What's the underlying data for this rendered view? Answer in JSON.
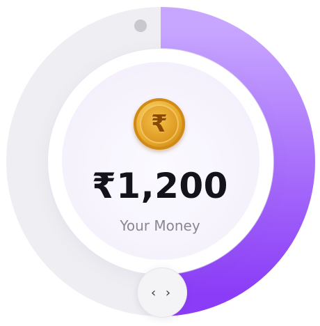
{
  "balance": {
    "currency_symbol": "₹",
    "amount_text": "₹1,200",
    "caption": "Your Money",
    "progress_fraction": 0.5
  },
  "coin": {
    "symbol": "₹"
  },
  "handle": {
    "glyph": "‹ ›",
    "icon": "chevrons-left-right-icon"
  },
  "colors": {
    "ring_track": "#efeef2",
    "ring_fill_start": "#c7a6ff",
    "ring_fill_end": "#8b3cf7",
    "amount_text": "#14121a",
    "caption_text": "#8a8790"
  }
}
